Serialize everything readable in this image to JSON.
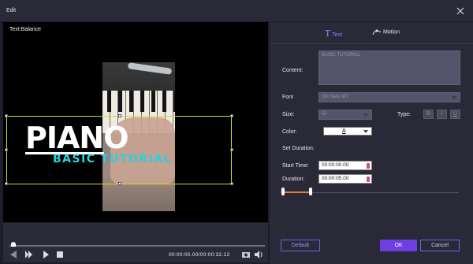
{
  "window": {
    "title": "Edit"
  },
  "preview": {
    "label": "Text:Balance",
    "title_text": "PIANO",
    "subtitle_text": "BASIC TUTORIAL",
    "title_color": "#ffffff",
    "subtitle_color": "#27d3df",
    "selection_color": "#d9d72a"
  },
  "playback": {
    "timecode": "00:00:00.00/00:00:32.12",
    "progress_fraction": 0.01
  },
  "tabs": [
    {
      "label": "Text",
      "active": true
    },
    {
      "label": "Motion",
      "active": false
    }
  ],
  "form": {
    "content_label": "Content:",
    "content_value": "BASIC TUTORIAL",
    "font_label": "Font",
    "font_value": "Gill Sans MT",
    "size_label": "Size:",
    "size_value": "50",
    "type_label": "Type:",
    "type_buttons": [
      "B",
      "I",
      "U"
    ],
    "color_label": "Color:",
    "color_value": "A",
    "duration_heading": "Set Duration:",
    "start_label": "Start Time:",
    "start_value": "00:00:00.00",
    "duration_label": "Duration:",
    "duration_value": "00:00:05.00"
  },
  "buttons": {
    "default": "Default",
    "ok": "OK",
    "cancel": "Cancel"
  },
  "colors": {
    "accent": "#6d3fe3",
    "active_tab": "#8a87ff",
    "range": "#e87a3d"
  },
  "icons": [
    "close-icon",
    "text-icon",
    "motion-icon",
    "previous-icon",
    "play-icon",
    "play-small-icon",
    "stop-icon",
    "camera-icon",
    "volume-icon"
  ]
}
